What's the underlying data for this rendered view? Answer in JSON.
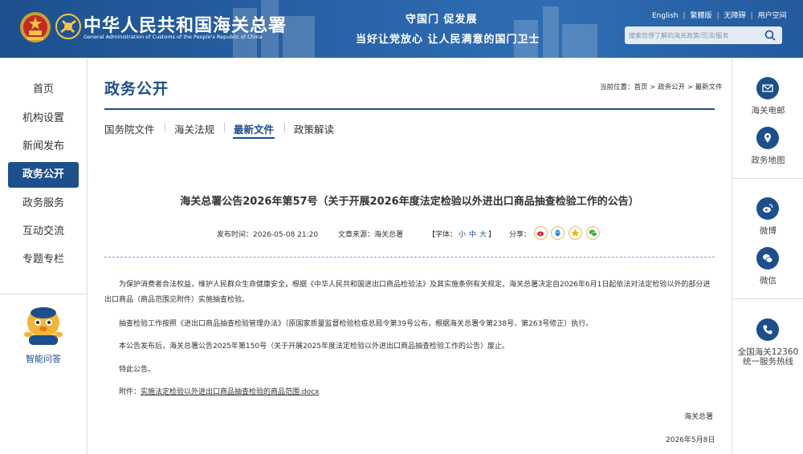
{
  "header": {
    "org_name_cn": "中华人民共和国海关总署",
    "org_name_en": "General Administration of Customs of the People's Republic of China",
    "slogan_1": "守国门 促发展",
    "slogan_2": "当好让党放心 让人民满意的国门卫士",
    "links": [
      "English",
      "繁體版",
      "无障碍",
      "用户空间"
    ],
    "search_placeholder": "搜索您想了解的海关政策/司法/服务"
  },
  "left_nav": {
    "items": [
      "首页",
      "机构设置",
      "新闻发布",
      "政务公开",
      "政务服务",
      "互动交流",
      "专题专栏"
    ],
    "active_item": "政务公开",
    "assistant_label": "智能问答"
  },
  "right_rail": {
    "items": [
      "海关电邮",
      "政务地图",
      "微博",
      "微信",
      "全国海关12360",
      "统一服务热线"
    ]
  },
  "main": {
    "section_title": "政务公开",
    "breadcrumb": {
      "prefix": "当前位置：",
      "items": [
        "首页",
        "政务公开",
        "最新文件"
      ],
      "separator": " > "
    },
    "tabs": [
      "国务院文件",
      "海关法规",
      "最新文件",
      "政策解读"
    ],
    "active_tab": "最新文件"
  },
  "article": {
    "title": "海关总署公告2026年第57号（关于开展2026年度法定检验以外进出口商品抽查检验工作的公告）",
    "publish_time_label": "发布时间：",
    "publish_time": "2026-05-08 21:20",
    "source_label": "文章来源：",
    "source": "海关总署",
    "font_label_open": "【字体：",
    "font_sizes": [
      "小",
      "中",
      "大"
    ],
    "font_label_close": "】",
    "share_label": "分享：",
    "share_icons": [
      "weibo-icon",
      "qq-icon",
      "qzone-icon",
      "wechat-icon"
    ],
    "paragraphs": [
      "为保护消费者合法权益，维护人民群众生命健康安全，根据《中华人民共和国进出口商品检验法》及其实施条例有关规定，海关总署决定自2026年6月1日起依法对法定检验以外的部分进出口商品（商品范围见附件）实施抽查检验。",
      "抽查检验工作按照《进出口商品抽查检验管理办法》（原国家质量监督检验检疫总局令第39号公布，根据海关总署令第238号、第263号修正）执行。",
      "本公告发布后，海关总署公告2025年第150号（关于开展2025年度法定检验以外进出口商品抽查检验工作的公告）废止。",
      "特此公告。"
    ],
    "attachment_label": "附件：",
    "attachment_name": "实施法定检验以外进出口商品抽查检验的商品范围.docx",
    "signature": "海关总署",
    "date": "2026年5月8日"
  },
  "colors": {
    "brand_blue": "#1c4f8c",
    "header_blue": "#2a64a8"
  }
}
